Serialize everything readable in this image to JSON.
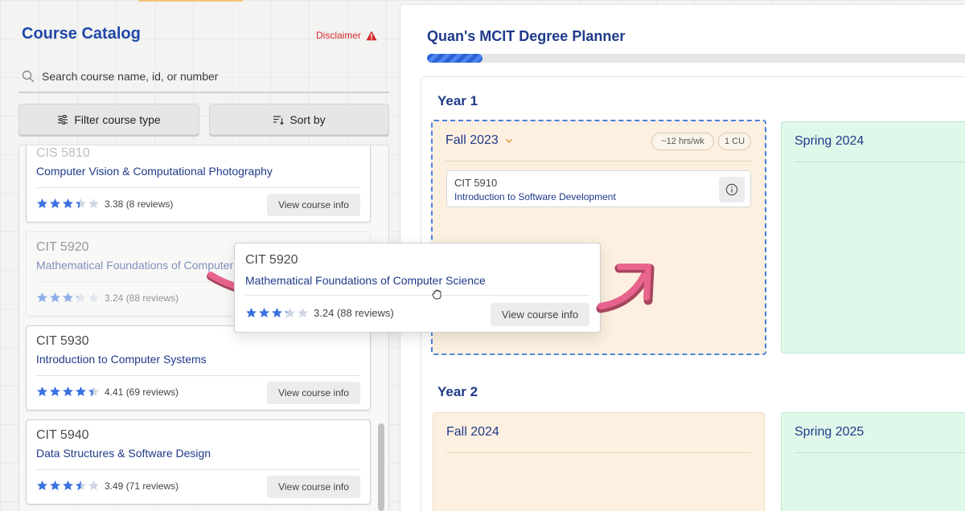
{
  "catalog": {
    "title": "Course Catalog",
    "disclaimer_label": "Disclaimer",
    "disclaimer_icon": "warning-triangle-icon",
    "search_placeholder": "Search course name, id, or number",
    "filter_label": "Filter course type",
    "sort_label": "Sort by",
    "courses": [
      {
        "code": "CIS 5810",
        "name": "Computer Vision & Computational Photography",
        "rating": 3.38,
        "rating_text": "3.38 (8 reviews)",
        "button": "View course info"
      },
      {
        "code": "CIT 5920",
        "name": "Mathematical Foundations of Computer Science",
        "rating": 3.24,
        "rating_text": "3.24 (88 reviews)",
        "button": "View course info"
      },
      {
        "code": "CIT 5930",
        "name": "Introduction to Computer Systems",
        "rating": 4.41,
        "rating_text": "4.41 (69 reviews)",
        "button": "View course info"
      },
      {
        "code": "CIT 5940",
        "name": "Data Structures & Software Design",
        "rating": 3.49,
        "rating_text": "3.49 (71 reviews)",
        "button": "View course info"
      }
    ]
  },
  "drag": {
    "code": "CIT 5920",
    "name": "Mathematical Foundations of Computer Science",
    "rating": 3.24,
    "rating_text": "3.24 (88 reviews)",
    "button": "View course info"
  },
  "planner": {
    "title": "Quan's MCIT Degree Planner",
    "progress": 0.1,
    "years": [
      {
        "label": "Year 1",
        "semesters": [
          {
            "name": "Fall 2023",
            "hours": "~12 hrs/wk",
            "cu": "1 CU",
            "courses": [
              {
                "code": "CIT 5910",
                "name": "Introduction to Software Development"
              }
            ]
          },
          {
            "name": "Spring 2024"
          }
        ]
      },
      {
        "label": "Year 2",
        "semesters": [
          {
            "name": "Fall 2024"
          },
          {
            "name": "Spring 2025"
          }
        ]
      }
    ]
  },
  "colors": {
    "accent": "#1f3a8a",
    "title_blue": "#1f47a8",
    "star_filled": "#3b72e0",
    "star_empty": "#cfd6e4",
    "fall_bg": "#fdf0e0",
    "spring_bg": "#e0f8ea",
    "disclaimer_red": "#d52a2a",
    "arrow_pink": "#e8648e"
  }
}
